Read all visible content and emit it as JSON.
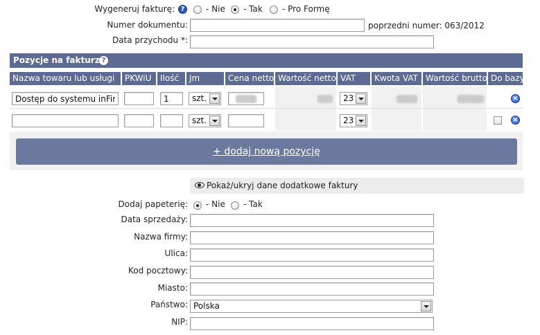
{
  "generate": {
    "label": "Wygeneruj fakturę:",
    "options": [
      "- Nie",
      "- Tak",
      "- Pro Formę"
    ],
    "selected": "- Tak"
  },
  "document_number": {
    "label": "Numer dokumentu:",
    "value": "",
    "previous": "poprzedni numer: 063/2012"
  },
  "income_date": {
    "label": "Data przychodu *:",
    "value": ""
  },
  "positions": {
    "title": "Pozycje na fakturze",
    "columns": [
      "Nazwa towaru lub usługi",
      "PKWiU",
      "Ilość",
      "Jm",
      "Cena netto",
      "Wartość netto",
      "VAT",
      "Kwota VAT",
      "Wartość brutto",
      "Do bazy"
    ],
    "rows": [
      {
        "name": "Dostęp do systemu inFirma",
        "pkwiu": "",
        "qty": "1",
        "unit": "szt.",
        "vat": "23"
      },
      {
        "name": "",
        "pkwiu": "",
        "qty": "",
        "unit": "szt.",
        "vat": "23"
      }
    ],
    "add_label": "+ dodaj nową pozycję"
  },
  "toggle_extra": "Pokaż/ukryj dane dodatkowe faktury",
  "stationery": {
    "label": "Dodaj papeterię:",
    "options": [
      "- Nie",
      "- Tak"
    ],
    "selected": "- Nie"
  },
  "extra_fields": {
    "sale_date": "Data sprzedaży:",
    "company": "Nazwa firmy:",
    "street": "Ulica:",
    "postal": "Kod pocztowy:",
    "city": "Miasto:",
    "country": "Państwo:",
    "country_value": "Polska",
    "nip": "NIP:"
  },
  "colors": {
    "header": "#5d6a93",
    "button": "#6c799f",
    "row_bg": "#f1f1f1"
  }
}
